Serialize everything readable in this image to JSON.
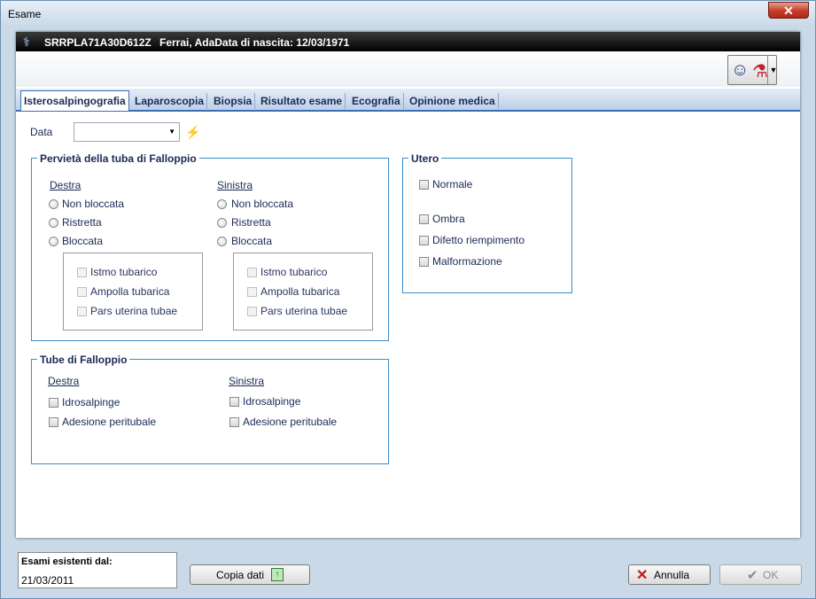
{
  "window": {
    "title": "Esame",
    "close_glyph": "✕"
  },
  "patient": {
    "id": "SRRPLA71A30D612Z",
    "name_birth": "Ferrai, AdaData di nascita: 12/03/1971"
  },
  "tabs": [
    "Isterosalpingografia",
    "Laparoscopia",
    "Biopsia",
    "Risultato esame",
    "Ecografia",
    "Opinione medica"
  ],
  "active_tab": "Isterosalpingografia",
  "date_field": {
    "label": "Data",
    "value": ""
  },
  "pervieta": {
    "title": "Pervietà della tuba di Falloppio",
    "destra": {
      "heading": "Destra",
      "options": [
        "Non bloccata",
        "Ristretta",
        "Bloccata"
      ],
      "sub": [
        "Istmo tubarico",
        "Ampolla tubarica",
        "Pars uterina tubae"
      ]
    },
    "sinistra": {
      "heading": "Sinistra",
      "options": [
        "Non bloccata",
        "Ristretta",
        "Bloccata"
      ],
      "sub": [
        "Istmo tubarico",
        "Ampolla tubarica",
        "Pars uterina tubae"
      ]
    }
  },
  "tube": {
    "title": "Tube di Falloppio",
    "destra": {
      "heading": "Destra",
      "items": [
        "Idrosalpinge",
        "Adesione peritubale"
      ]
    },
    "sinistra": {
      "heading": "Sinistra",
      "items": [
        "Idrosalpinge",
        "Adesione peritubale"
      ]
    }
  },
  "utero": {
    "title": "Utero",
    "items": [
      "Normale",
      "Ombra",
      "Difetto riempimento",
      "Malformazione"
    ]
  },
  "footer": {
    "existing_label": "Esami esistenti dal:",
    "existing_value": "21/03/2011",
    "copy_label": "Copia dati",
    "cancel_label": "Annulla",
    "ok_label": "OK"
  },
  "icons": {
    "header": "patient-lab-icon",
    "close": "close-icon",
    "copy": "copy-data-icon",
    "cancel": "cancel-x-icon",
    "ok": "checkmark-icon",
    "today": "lightning-icon"
  }
}
